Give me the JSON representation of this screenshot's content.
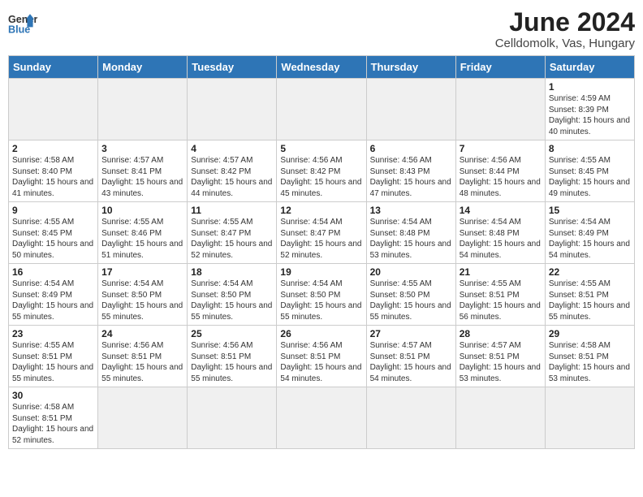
{
  "header": {
    "logo_general": "General",
    "logo_blue": "Blue",
    "title": "June 2024",
    "subtitle": "Celldomolk, Vas, Hungary"
  },
  "days_of_week": [
    "Sunday",
    "Monday",
    "Tuesday",
    "Wednesday",
    "Thursday",
    "Friday",
    "Saturday"
  ],
  "weeks": [
    [
      {
        "day": "",
        "info": ""
      },
      {
        "day": "",
        "info": ""
      },
      {
        "day": "",
        "info": ""
      },
      {
        "day": "",
        "info": ""
      },
      {
        "day": "",
        "info": ""
      },
      {
        "day": "",
        "info": ""
      },
      {
        "day": "1",
        "info": "Sunrise: 4:59 AM\nSunset: 8:39 PM\nDaylight: 15 hours and 40 minutes."
      }
    ],
    [
      {
        "day": "2",
        "info": "Sunrise: 4:58 AM\nSunset: 8:40 PM\nDaylight: 15 hours and 41 minutes."
      },
      {
        "day": "3",
        "info": "Sunrise: 4:57 AM\nSunset: 8:41 PM\nDaylight: 15 hours and 43 minutes."
      },
      {
        "day": "4",
        "info": "Sunrise: 4:57 AM\nSunset: 8:42 PM\nDaylight: 15 hours and 44 minutes."
      },
      {
        "day": "5",
        "info": "Sunrise: 4:56 AM\nSunset: 8:42 PM\nDaylight: 15 hours and 45 minutes."
      },
      {
        "day": "6",
        "info": "Sunrise: 4:56 AM\nSunset: 8:43 PM\nDaylight: 15 hours and 47 minutes."
      },
      {
        "day": "7",
        "info": "Sunrise: 4:56 AM\nSunset: 8:44 PM\nDaylight: 15 hours and 48 minutes."
      },
      {
        "day": "8",
        "info": "Sunrise: 4:55 AM\nSunset: 8:45 PM\nDaylight: 15 hours and 49 minutes."
      }
    ],
    [
      {
        "day": "9",
        "info": "Sunrise: 4:55 AM\nSunset: 8:45 PM\nDaylight: 15 hours and 50 minutes."
      },
      {
        "day": "10",
        "info": "Sunrise: 4:55 AM\nSunset: 8:46 PM\nDaylight: 15 hours and 51 minutes."
      },
      {
        "day": "11",
        "info": "Sunrise: 4:55 AM\nSunset: 8:47 PM\nDaylight: 15 hours and 52 minutes."
      },
      {
        "day": "12",
        "info": "Sunrise: 4:54 AM\nSunset: 8:47 PM\nDaylight: 15 hours and 52 minutes."
      },
      {
        "day": "13",
        "info": "Sunrise: 4:54 AM\nSunset: 8:48 PM\nDaylight: 15 hours and 53 minutes."
      },
      {
        "day": "14",
        "info": "Sunrise: 4:54 AM\nSunset: 8:48 PM\nDaylight: 15 hours and 54 minutes."
      },
      {
        "day": "15",
        "info": "Sunrise: 4:54 AM\nSunset: 8:49 PM\nDaylight: 15 hours and 54 minutes."
      }
    ],
    [
      {
        "day": "16",
        "info": "Sunrise: 4:54 AM\nSunset: 8:49 PM\nDaylight: 15 hours and 55 minutes."
      },
      {
        "day": "17",
        "info": "Sunrise: 4:54 AM\nSunset: 8:50 PM\nDaylight: 15 hours and 55 minutes."
      },
      {
        "day": "18",
        "info": "Sunrise: 4:54 AM\nSunset: 8:50 PM\nDaylight: 15 hours and 55 minutes."
      },
      {
        "day": "19",
        "info": "Sunrise: 4:54 AM\nSunset: 8:50 PM\nDaylight: 15 hours and 55 minutes."
      },
      {
        "day": "20",
        "info": "Sunrise: 4:55 AM\nSunset: 8:50 PM\nDaylight: 15 hours and 55 minutes."
      },
      {
        "day": "21",
        "info": "Sunrise: 4:55 AM\nSunset: 8:51 PM\nDaylight: 15 hours and 56 minutes."
      },
      {
        "day": "22",
        "info": "Sunrise: 4:55 AM\nSunset: 8:51 PM\nDaylight: 15 hours and 55 minutes."
      }
    ],
    [
      {
        "day": "23",
        "info": "Sunrise: 4:55 AM\nSunset: 8:51 PM\nDaylight: 15 hours and 55 minutes."
      },
      {
        "day": "24",
        "info": "Sunrise: 4:56 AM\nSunset: 8:51 PM\nDaylight: 15 hours and 55 minutes."
      },
      {
        "day": "25",
        "info": "Sunrise: 4:56 AM\nSunset: 8:51 PM\nDaylight: 15 hours and 55 minutes."
      },
      {
        "day": "26",
        "info": "Sunrise: 4:56 AM\nSunset: 8:51 PM\nDaylight: 15 hours and 54 minutes."
      },
      {
        "day": "27",
        "info": "Sunrise: 4:57 AM\nSunset: 8:51 PM\nDaylight: 15 hours and 54 minutes."
      },
      {
        "day": "28",
        "info": "Sunrise: 4:57 AM\nSunset: 8:51 PM\nDaylight: 15 hours and 53 minutes."
      },
      {
        "day": "29",
        "info": "Sunrise: 4:58 AM\nSunset: 8:51 PM\nDaylight: 15 hours and 53 minutes."
      }
    ],
    [
      {
        "day": "30",
        "info": "Sunrise: 4:58 AM\nSunset: 8:51 PM\nDaylight: 15 hours and 52 minutes."
      },
      {
        "day": "",
        "info": ""
      },
      {
        "day": "",
        "info": ""
      },
      {
        "day": "",
        "info": ""
      },
      {
        "day": "",
        "info": ""
      },
      {
        "day": "",
        "info": ""
      },
      {
        "day": "",
        "info": ""
      }
    ]
  ],
  "colors": {
    "header_bg": "#2e75b6",
    "header_text": "#ffffff",
    "border": "#cccccc",
    "empty_cell": "#f0f0f0"
  }
}
